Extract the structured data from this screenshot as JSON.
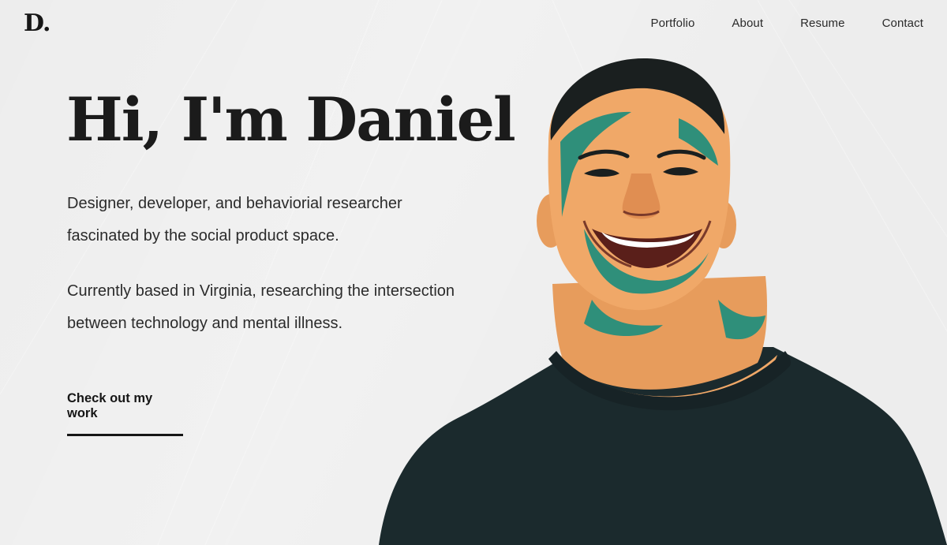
{
  "brand": {
    "logo": "D."
  },
  "nav": {
    "items": [
      "Portfolio",
      "About",
      "Resume",
      "Contact"
    ]
  },
  "hero": {
    "title": "Hi, I'm Daniel",
    "paragraph1_line1": "Designer, developer, and behaviorial researcher",
    "paragraph1_line2": "fascinated by the social product space.",
    "paragraph2_line1": "Currently based in Virginia, researching the intersection",
    "paragraph2_line2": "between technology and mental illness.",
    "cta": "Check out my work"
  },
  "colors": {
    "background": "#ededed",
    "text": "#1b1b1b",
    "skin_orange": "#f0a060",
    "skin_teal": "#2f8f7a",
    "shirt": "#1b2a2d"
  },
  "icons": {
    "portrait": "person-photo"
  }
}
